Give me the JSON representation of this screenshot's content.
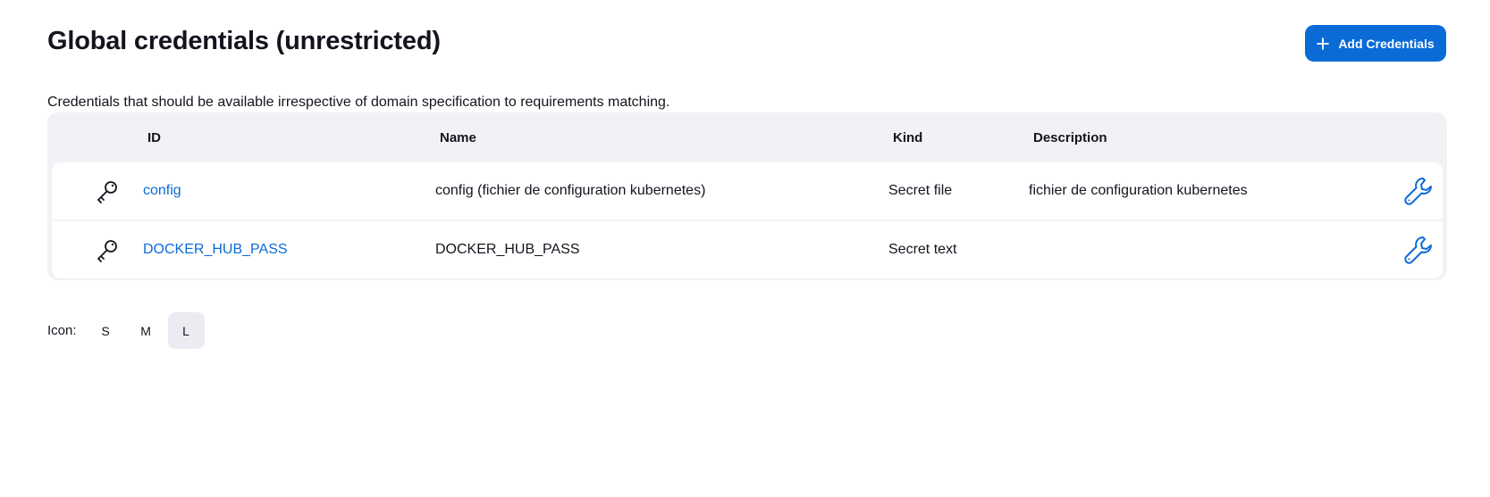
{
  "header": {
    "title": "Global credentials (unrestricted)",
    "add_button_label": "Add Credentials"
  },
  "description": "Credentials that should be available irrespective of domain specification to requirements matching.",
  "table": {
    "columns": [
      "ID",
      "Name",
      "Kind",
      "Description"
    ],
    "rows": [
      {
        "icon": "key-icon",
        "id": "config",
        "name": "config (fichier de configuration kubernetes)",
        "kind": "Secret file",
        "description": "fichier de configuration kubernetes",
        "action_icon": "wrench-icon"
      },
      {
        "icon": "key-icon",
        "id": "DOCKER_HUB_PASS",
        "name": "DOCKER_HUB_PASS",
        "kind": "Secret text",
        "description": "",
        "action_icon": "wrench-icon"
      }
    ]
  },
  "icon_size": {
    "label": "Icon:",
    "options": [
      "S",
      "M",
      "L"
    ],
    "selected": "L"
  },
  "colors": {
    "accent": "#0b6bd6",
    "table_bg": "#f2f2f6"
  }
}
